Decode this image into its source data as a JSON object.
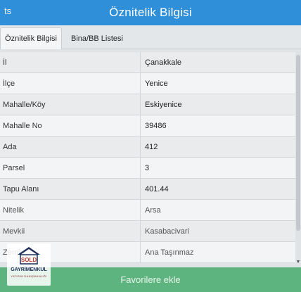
{
  "header": {
    "back_label": "ts",
    "title": "Öznitelik Bilgisi"
  },
  "tabs": [
    {
      "label": "Öznitelik Bilgisi",
      "active": true
    },
    {
      "label": "Bina/BB Listesi",
      "active": false
    }
  ],
  "attributes": [
    {
      "label": "İl",
      "value": "Çanakkale"
    },
    {
      "label": "İlçe",
      "value": "Yenice"
    },
    {
      "label": "Mahalle/Köy",
      "value": "Eskiyenice"
    },
    {
      "label": "Mahalle No",
      "value": "39486"
    },
    {
      "label": "Ada",
      "value": "412"
    },
    {
      "label": "Parsel",
      "value": "3"
    },
    {
      "label": "Tapu Alanı",
      "value": "401.44"
    },
    {
      "label": "Nitelik",
      "value": "Arsa"
    },
    {
      "label": "Mevkii",
      "value": "Kasabacivari"
    },
    {
      "label": "Zemin",
      "value": "Ana Taşınmaz"
    }
  ],
  "footer": {
    "favorite_label": "Favorilere ekle"
  },
  "watermark": {
    "logo_text": "SOLD",
    "company": "GAYRİMENKUL",
    "tagline": "YATIRIM DANIŞMANLIĞI"
  },
  "colors": {
    "header_bg": "#2f8fd8",
    "button_bg": "#5db47e"
  }
}
